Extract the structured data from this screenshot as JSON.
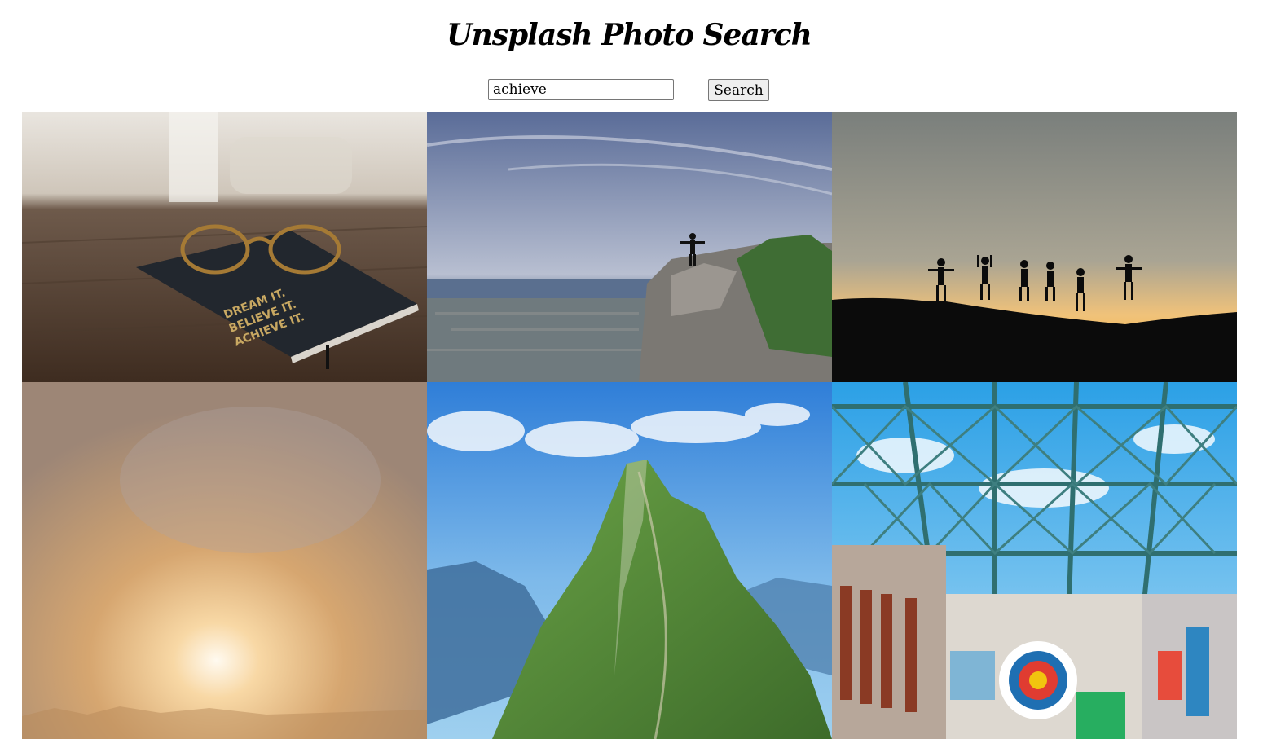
{
  "header": {
    "title": "Unsplash Photo Search"
  },
  "search": {
    "value": "achieve",
    "button_label": "Search"
  },
  "results": [
    {
      "name": "photo-notebook-glasses",
      "engraving": [
        "DREAM IT.",
        "BELIEVE IT.",
        "ACHIEVE IT."
      ]
    },
    {
      "name": "photo-cliff-person"
    },
    {
      "name": "photo-jumping-silhouettes"
    },
    {
      "name": "photo-hazy-sunrise"
    },
    {
      "name": "photo-green-mountain"
    },
    {
      "name": "photo-target-warehouse"
    }
  ]
}
